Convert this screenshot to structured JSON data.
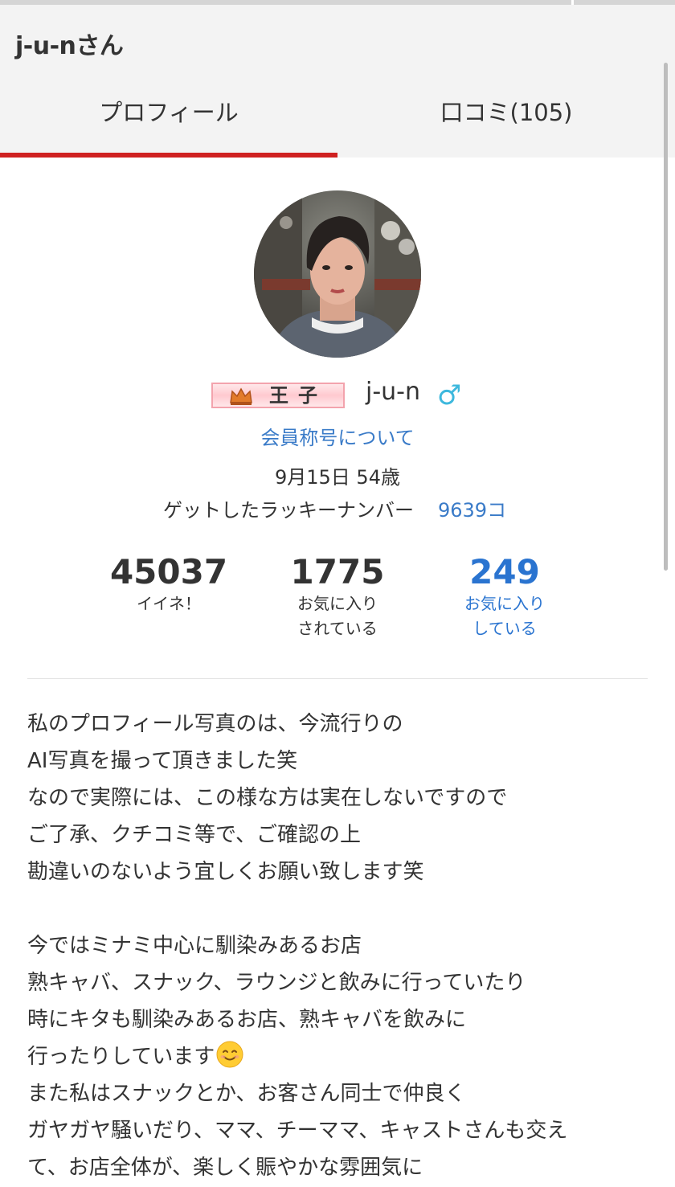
{
  "header": {
    "title": "j-u-nさん",
    "tabs": [
      {
        "label": "プロフィール",
        "active": true
      },
      {
        "label": "口コミ(105)",
        "active": false
      }
    ]
  },
  "profile": {
    "rank_label": "王子",
    "username": "j-u-n",
    "gender_symbol": "♂",
    "title_link": "会員称号について",
    "birthday": "9月15日 54歳",
    "lucky_number_label": "ゲットしたラッキーナンバー",
    "lucky_number_value": "9639コ"
  },
  "stats": [
    {
      "value": "45037",
      "label_line1": "イイネ！",
      "label_line2": ""
    },
    {
      "value": "1775",
      "label_line1": "お気に入り",
      "label_line2": "されている"
    },
    {
      "value": "249",
      "label_line1": "お気に入り",
      "label_line2": "している"
    }
  ],
  "bio": {
    "lines": [
      "私のプロフィール写真のは、今流行りの",
      "AI写真を撮って頂きました笑",
      "なので実際には、この様な方は実在しないですので",
      "ご了承、クチコミ等で、ご確認の上",
      "勘違いのないよう宜しくお願い致します笑",
      "",
      "今ではミナミ中心に馴染みあるお店",
      "熟キャバ、スナック、ラウンジと飲みに行っていたり",
      "時にキタも馴染みあるお店、熟キャバを飲みに",
      "行ったりしています",
      "また私はスナックとか、お客さん同士で仲良く",
      "ガヤガヤ騒いだり、ママ、チーママ、キャストさんも交え",
      "て、お店全体が、楽しく賑やかな雰囲気に"
    ],
    "emoji": "smiling-face-emoji"
  },
  "colors": {
    "accent_red": "#cf2121",
    "link_blue": "#3a7bc8",
    "stat_blue": "#2a74d0",
    "gender_blue": "#3db8dd",
    "header_bg": "#f3f3f3"
  }
}
